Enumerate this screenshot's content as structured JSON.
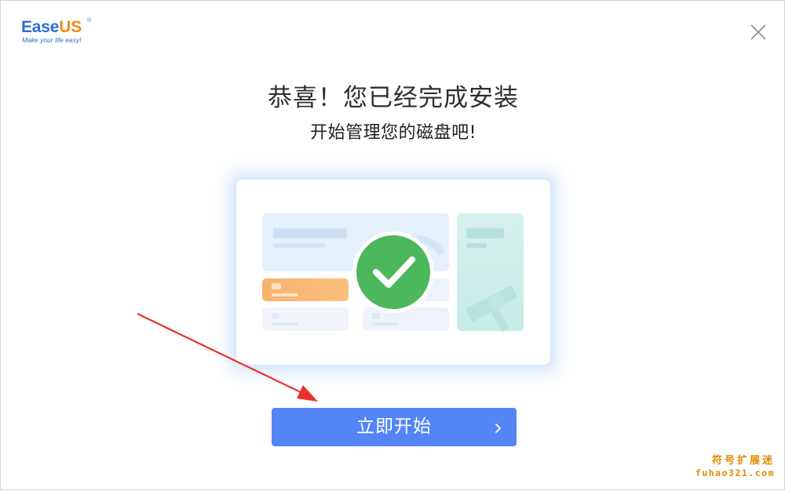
{
  "app": {
    "brand": {
      "word_main": "Ease",
      "word_accent": "US",
      "registered": "®",
      "tagline": "Make your life easy!"
    },
    "close_icon": "close-icon"
  },
  "completion": {
    "title": "恭喜！您已经完成安装",
    "subtitle": "开始管理您的磁盘吧!",
    "illustration_icon": "success-check-icon"
  },
  "actions": {
    "start_label": "立即开始",
    "start_icon": "chevron-right-icon"
  },
  "watermark": {
    "line1": "符号扩展迷",
    "line2": "fuhao321.com"
  },
  "colors": {
    "brand_blue": "#2d6ed4",
    "brand_orange": "#f28a1c",
    "button_blue": "#5385f6",
    "success_green": "#4cb75c",
    "annotation_red": "#e8312f",
    "watermark_orange": "#e08a00"
  }
}
